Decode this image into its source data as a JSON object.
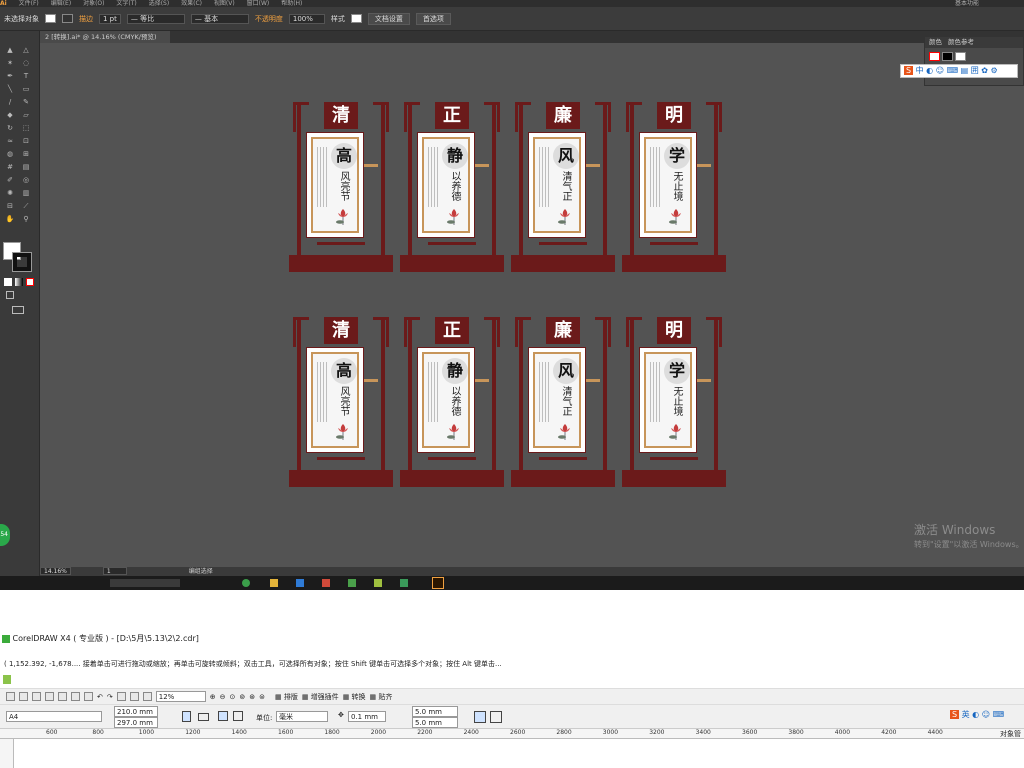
{
  "ai": {
    "menu": [
      "Ai",
      "文件(F)",
      "编辑(E)",
      "对象(O)",
      "文字(T)",
      "选择(S)",
      "效果(C)",
      "视图(V)",
      "窗口(W)",
      "帮助(H)"
    ],
    "menu_right": "基本功能",
    "control": {
      "selection_label": "未选择对象",
      "stroke_label": "描边",
      "stroke_weight": "1 pt",
      "profile1": "等比",
      "profile2": "基本",
      "opacity_label": "不透明度",
      "opacity_value": "100%",
      "style_label": "样式",
      "doc_setup": "文档设置",
      "preferences": "首选项"
    },
    "doc_tab": "2 [转换].ai* @ 14.16% (CMYK/预览)",
    "panel_tabs": [
      "颜色",
      "颜色参考"
    ],
    "ime_label": "中",
    "status_zoom": "14.16%",
    "status_page": "1",
    "status_mode": "编组选择",
    "windows_activate": "激活 Windows",
    "windows_activate_sub": "转到\"设置\"以激活 Windows。",
    "badge": "54"
  },
  "displays": [
    {
      "title": "清",
      "big": "高",
      "phrase": "风亮节"
    },
    {
      "title": "正",
      "big": "静",
      "phrase": "以养德"
    },
    {
      "title": "廉",
      "big": "风",
      "phrase": "清气正"
    },
    {
      "title": "明",
      "big": "学",
      "phrase": "无止境"
    }
  ],
  "cd": {
    "title": "CorelDRAW X4 ( 专业版 ) - [D:\\5月\\5.13\\2\\2.cdr]",
    "status": "( 1,152.392, -1,678.... 接着单击可进行拖动或缩放；再单击可旋转或倾斜；双击工具，可选择所有对象；按住 Shift 键单击可选择多个对象；按住 Alt 键单击...",
    "zoom": "12%",
    "toolbar_buttons": [
      "排版",
      "增强插件",
      "转换",
      "贴齐"
    ],
    "page_size": "A4",
    "width": "210.0 mm",
    "height": "297.0 mm",
    "unit_label": "单位:",
    "unit": "毫米",
    "nudge": "0.1 mm",
    "dup_x": "5.0 mm",
    "dup_y": "5.0 mm",
    "ime_label": "英",
    "ruler": [
      "600",
      "800",
      "1000",
      "1200",
      "1400",
      "1600",
      "1800",
      "2000",
      "2200",
      "2400",
      "2600",
      "2800",
      "3000",
      "3200",
      "3400",
      "3600",
      "3800",
      "4000",
      "4200",
      "4400"
    ],
    "docker_label": "对象管"
  }
}
